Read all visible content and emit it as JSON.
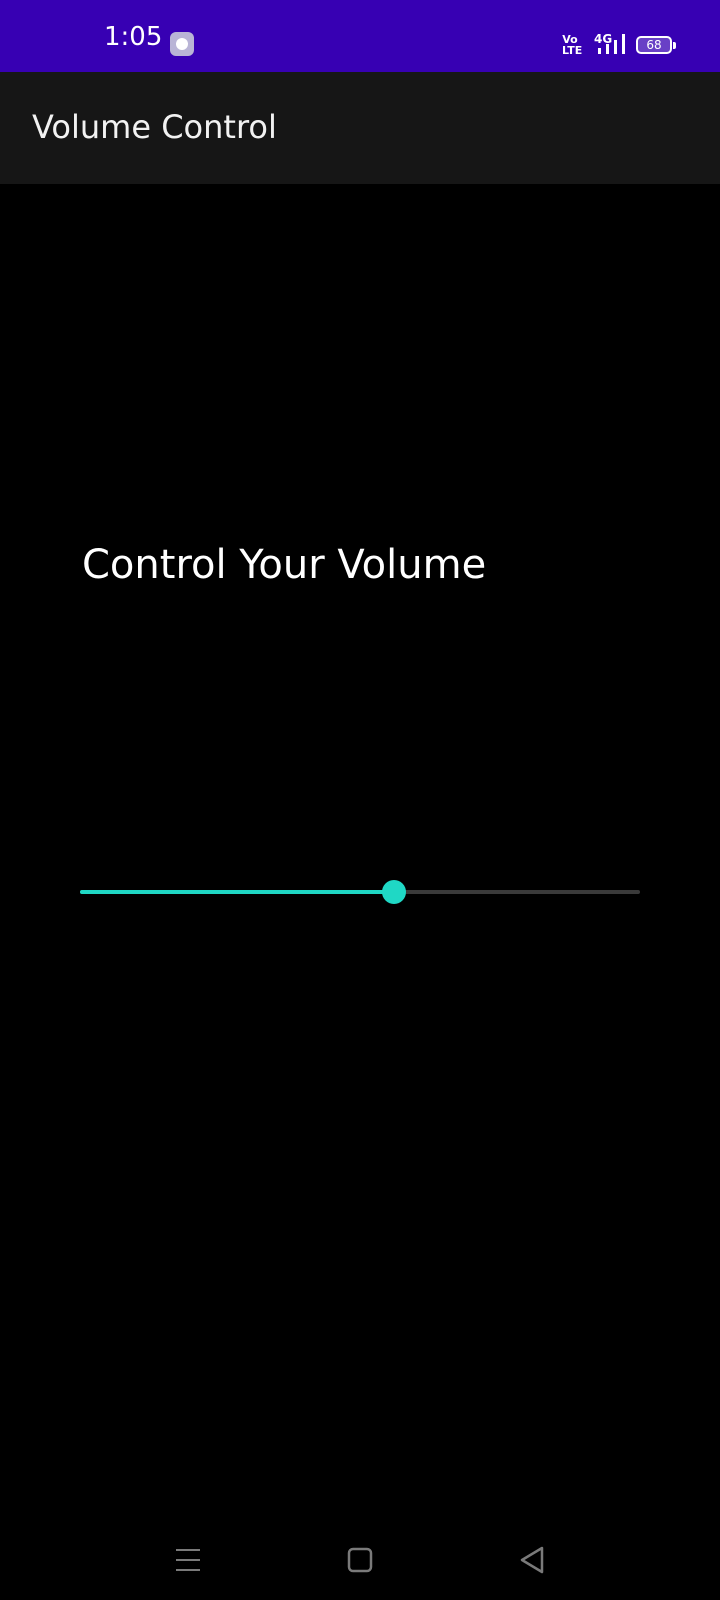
{
  "status_bar": {
    "time": "1:05",
    "volte_top": "Vo",
    "volte_bottom": "LTE",
    "network": "4G",
    "battery": "68",
    "background": "#3700b3"
  },
  "app_bar": {
    "title": "Volume Control"
  },
  "main": {
    "heading": "Control Your Volume",
    "slider": {
      "value_fraction": 0.56,
      "active_color": "#1fd8c5",
      "inactive_color": "#3a3a3a"
    }
  },
  "nav_bar": {
    "icons": [
      "menu-icon",
      "home-icon",
      "back-icon"
    ]
  }
}
